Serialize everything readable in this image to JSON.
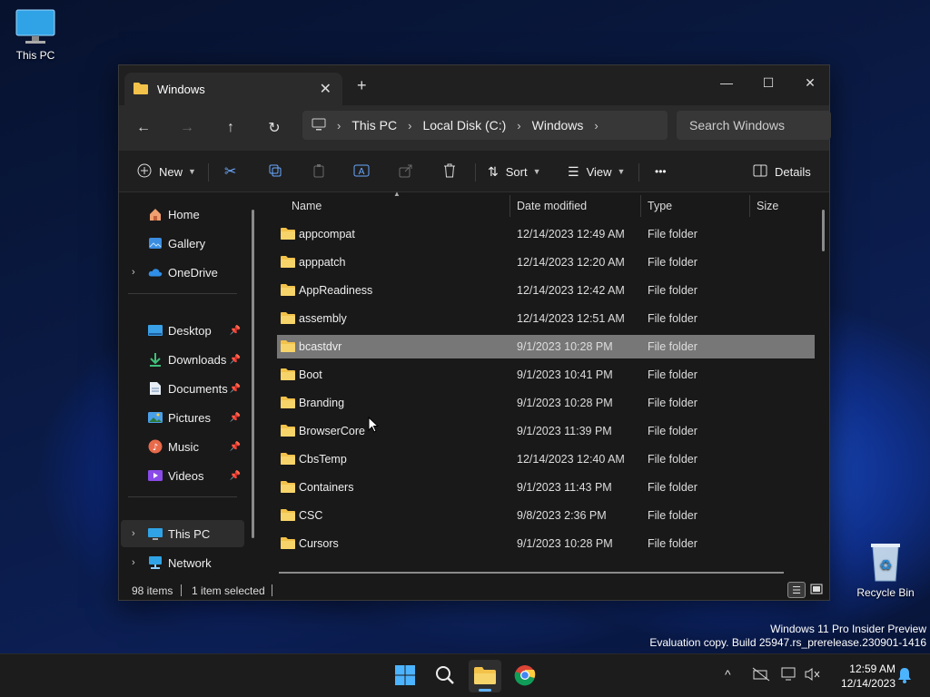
{
  "desktop": {
    "this_pc_label": "This PC",
    "recycle_bin_label": "Recycle Bin",
    "watermark_line1": "Windows 11 Pro Insider Preview",
    "watermark_line2": "Evaluation copy. Build 25947.rs_prerelease.230901-1416"
  },
  "window": {
    "tab_title": "Windows",
    "new_tab": "+",
    "minimize": "—",
    "maximize": "☐",
    "close": "✕"
  },
  "address": {
    "crumbs": [
      "This PC",
      "Local Disk (C:)",
      "Windows"
    ],
    "search_placeholder": "Search Windows"
  },
  "toolbar": {
    "new_label": "New",
    "sort_label": "Sort",
    "view_label": "View",
    "more_label": "•••",
    "details_label": "Details"
  },
  "sidebar": {
    "items": [
      {
        "label": "Home"
      },
      {
        "label": "Gallery"
      },
      {
        "label": "OneDrive"
      },
      {
        "label": "Desktop"
      },
      {
        "label": "Downloads"
      },
      {
        "label": "Documents"
      },
      {
        "label": "Pictures"
      },
      {
        "label": "Music"
      },
      {
        "label": "Videos"
      },
      {
        "label": "This PC"
      },
      {
        "label": "Network"
      }
    ]
  },
  "columns": {
    "name": "Name",
    "date": "Date modified",
    "type": "Type",
    "size": "Size"
  },
  "files": [
    {
      "name": "appcompat",
      "date": "12/14/2023 12:49 AM",
      "type": "File folder"
    },
    {
      "name": "apppatch",
      "date": "12/14/2023 12:20 AM",
      "type": "File folder"
    },
    {
      "name": "AppReadiness",
      "date": "12/14/2023 12:42 AM",
      "type": "File folder"
    },
    {
      "name": "assembly",
      "date": "12/14/2023 12:51 AM",
      "type": "File folder"
    },
    {
      "name": "bcastdvr",
      "date": "9/1/2023 10:28 PM",
      "type": "File folder"
    },
    {
      "name": "Boot",
      "date": "9/1/2023 10:41 PM",
      "type": "File folder"
    },
    {
      "name": "Branding",
      "date": "9/1/2023 10:28 PM",
      "type": "File folder"
    },
    {
      "name": "BrowserCore",
      "date": "9/1/2023 11:39 PM",
      "type": "File folder"
    },
    {
      "name": "CbsTemp",
      "date": "12/14/2023 12:40 AM",
      "type": "File folder"
    },
    {
      "name": "Containers",
      "date": "9/1/2023 11:43 PM",
      "type": "File folder"
    },
    {
      "name": "CSC",
      "date": "9/8/2023 2:36 PM",
      "type": "File folder"
    },
    {
      "name": "Cursors",
      "date": "9/1/2023 10:28 PM",
      "type": "File folder"
    }
  ],
  "status": {
    "count": "98 items",
    "selected": "1 item selected"
  },
  "taskbar": {
    "time": "12:59 AM",
    "date": "12/14/2023"
  },
  "colors": {
    "selection": "#777777",
    "accent": "#5fb2ff",
    "folder": "#f2c24a"
  }
}
